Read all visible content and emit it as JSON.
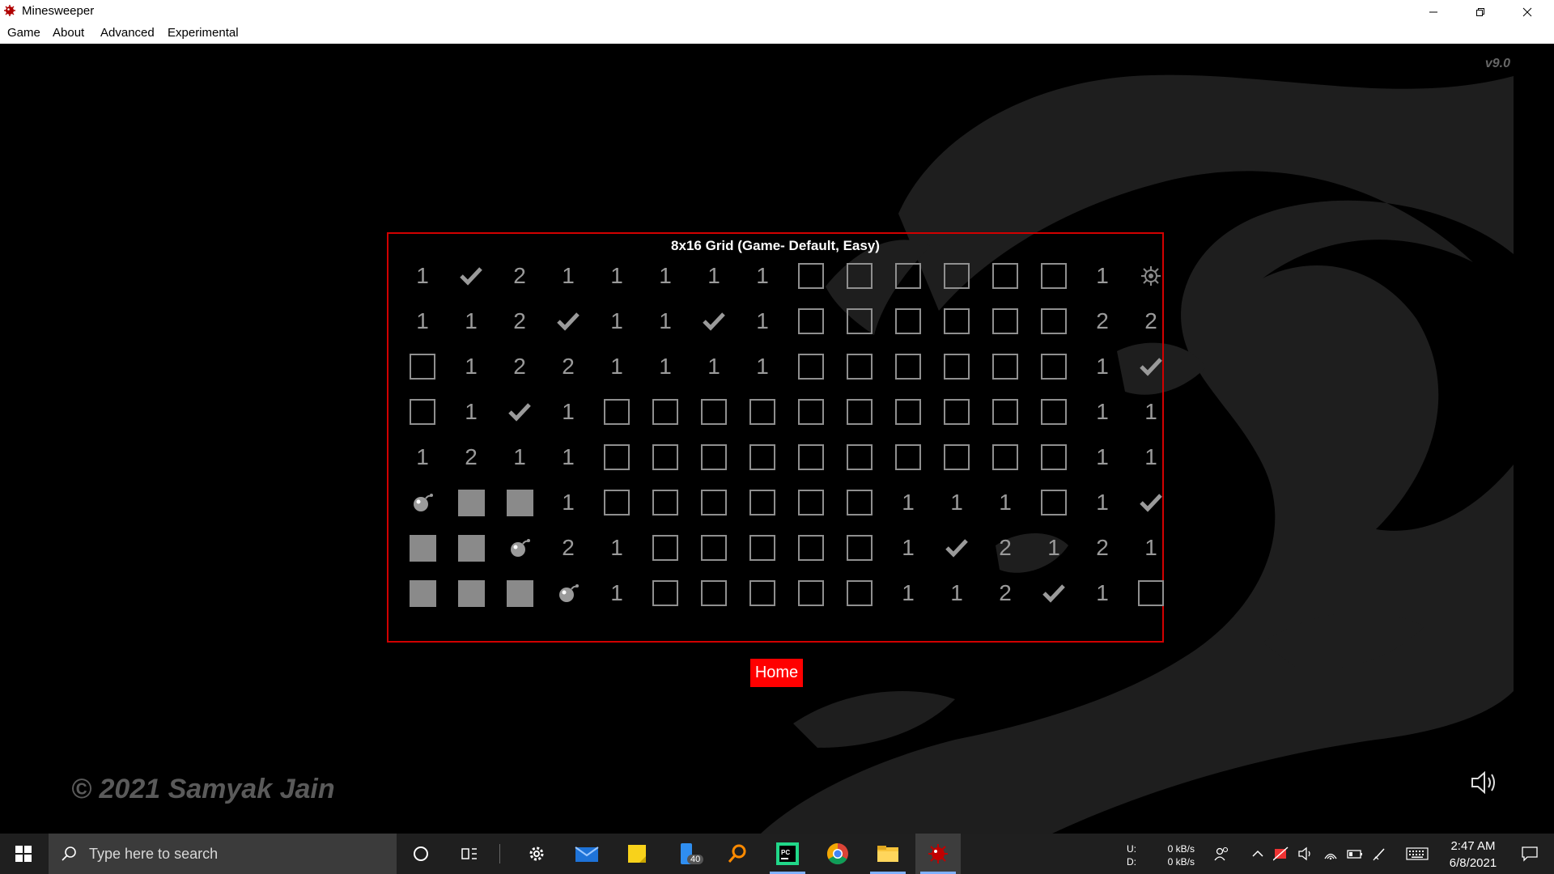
{
  "window": {
    "title": "Minesweeper"
  },
  "menu": [
    "Game",
    "About",
    "Advanced",
    "Experimental"
  ],
  "version": "v9.0",
  "copyright": "© 2021 Samyak Jain",
  "game": {
    "title": "8x16 Grid (Game- Default, Easy)",
    "home_label": "Home",
    "grid": [
      [
        "1",
        "check",
        "2",
        "1",
        "1",
        "1",
        "1",
        "1",
        "box",
        "box",
        "box",
        "box",
        "box",
        "box",
        "1",
        "mine-exploded"
      ],
      [
        "1",
        "1",
        "2",
        "check",
        "1",
        "1",
        "check",
        "1",
        "box",
        "box",
        "box",
        "box",
        "box",
        "box",
        "2",
        "2"
      ],
      [
        "box",
        "1",
        "2",
        "2",
        "1",
        "1",
        "1",
        "1",
        "box",
        "box",
        "box",
        "box",
        "box",
        "box",
        "1",
        "check"
      ],
      [
        "box",
        "1",
        "check",
        "1",
        "box",
        "box",
        "box",
        "box",
        "box",
        "box",
        "box",
        "box",
        "box",
        "box",
        "1",
        "1"
      ],
      [
        "1",
        "2",
        "1",
        "1",
        "box",
        "box",
        "box",
        "box",
        "box",
        "box",
        "box",
        "box",
        "box",
        "box",
        "1",
        "1"
      ],
      [
        "bomb",
        "filled",
        "filled",
        "1",
        "box",
        "box",
        "box",
        "box",
        "box",
        "box",
        "1",
        "1",
        "1",
        "box",
        "1",
        "check"
      ],
      [
        "filled",
        "filled",
        "bomb",
        "2",
        "1",
        "box",
        "box",
        "box",
        "box",
        "box",
        "1",
        "check",
        "2",
        "1",
        "2",
        "1"
      ],
      [
        "filled",
        "filled",
        "filled",
        "bomb",
        "1",
        "box",
        "box",
        "box",
        "box",
        "box",
        "1",
        "1",
        "2",
        "check",
        "1",
        "box"
      ]
    ]
  },
  "taskbar": {
    "search_placeholder": "Type here to search",
    "badge_count": "40",
    "net_upload_label": "U:",
    "net_download_label": "D:",
    "net_upload": "0 kB/s",
    "net_download": "0 kB/s",
    "time": "2:47 AM",
    "date": "6/8/2021",
    "icons": [
      "cortana-icon",
      "task-view-icon",
      "settings-icon",
      "mail-icon",
      "sticky-notes-icon",
      "phone-icon",
      "search-app-icon",
      "pycharm-icon",
      "chrome-icon",
      "file-explorer-icon",
      "minesweeper-icon"
    ]
  },
  "colors": {
    "accent": "#d10000",
    "home_button": "#ff0000",
    "cell": "#9a9a9a"
  }
}
